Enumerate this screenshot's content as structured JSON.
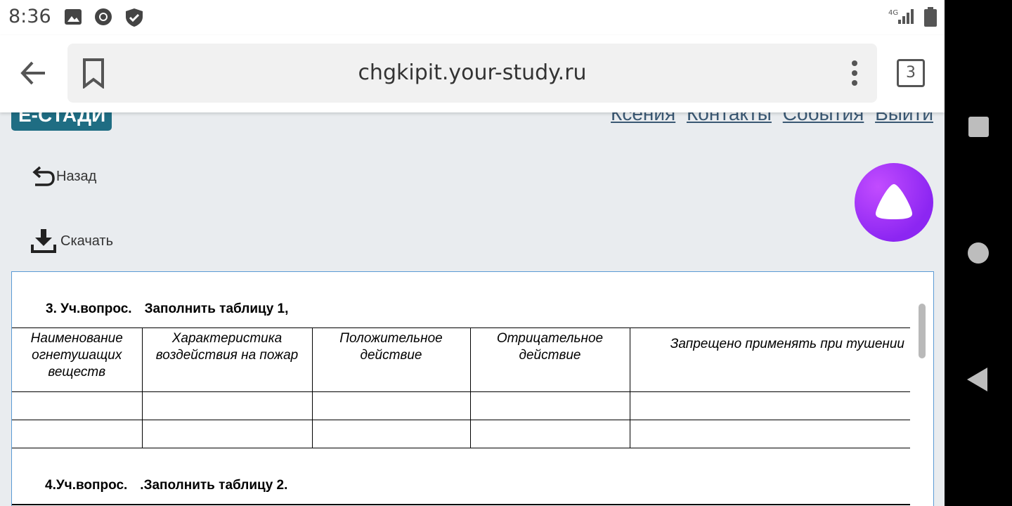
{
  "status_bar": {
    "time": "8:36",
    "left_icons": [
      "image-icon",
      "chrome-icon",
      "shield-check-icon"
    ],
    "right_icons": [
      "4g-signal-icon",
      "battery-icon"
    ],
    "network": "4G"
  },
  "browser": {
    "url": "chgkipit.your-study.ru",
    "tab_count": "3"
  },
  "site_header": {
    "logo_text": "Е-СТАДИ",
    "links": [
      "Ксения",
      "Контакты",
      "События",
      "Выйти"
    ]
  },
  "actions": {
    "back_label": "Назад",
    "download_label": "Скачать"
  },
  "document": {
    "q3_label": "3. Уч.вопрос.",
    "q3_text": "Заполнить таблицу 1,",
    "table1": {
      "headers": [
        "Наименование огнетушащих веществ",
        "Характеристика воздействия на пожар",
        "Положительное действие",
        "Отрицательное действие",
        "Запрещено применять при тушении"
      ],
      "rows": [
        [
          "",
          "",
          "",
          "",
          ""
        ],
        [
          "",
          "",
          "",
          "",
          ""
        ]
      ]
    },
    "q4_label": "4.Уч.вопрос.",
    "q4_text": ".Заполнить таблицу 2."
  },
  "colors": {
    "logo_bg": "#1f6d83",
    "link": "#3a5873",
    "doc_border": "#5b9bd5",
    "alice": "#8c26f2"
  }
}
